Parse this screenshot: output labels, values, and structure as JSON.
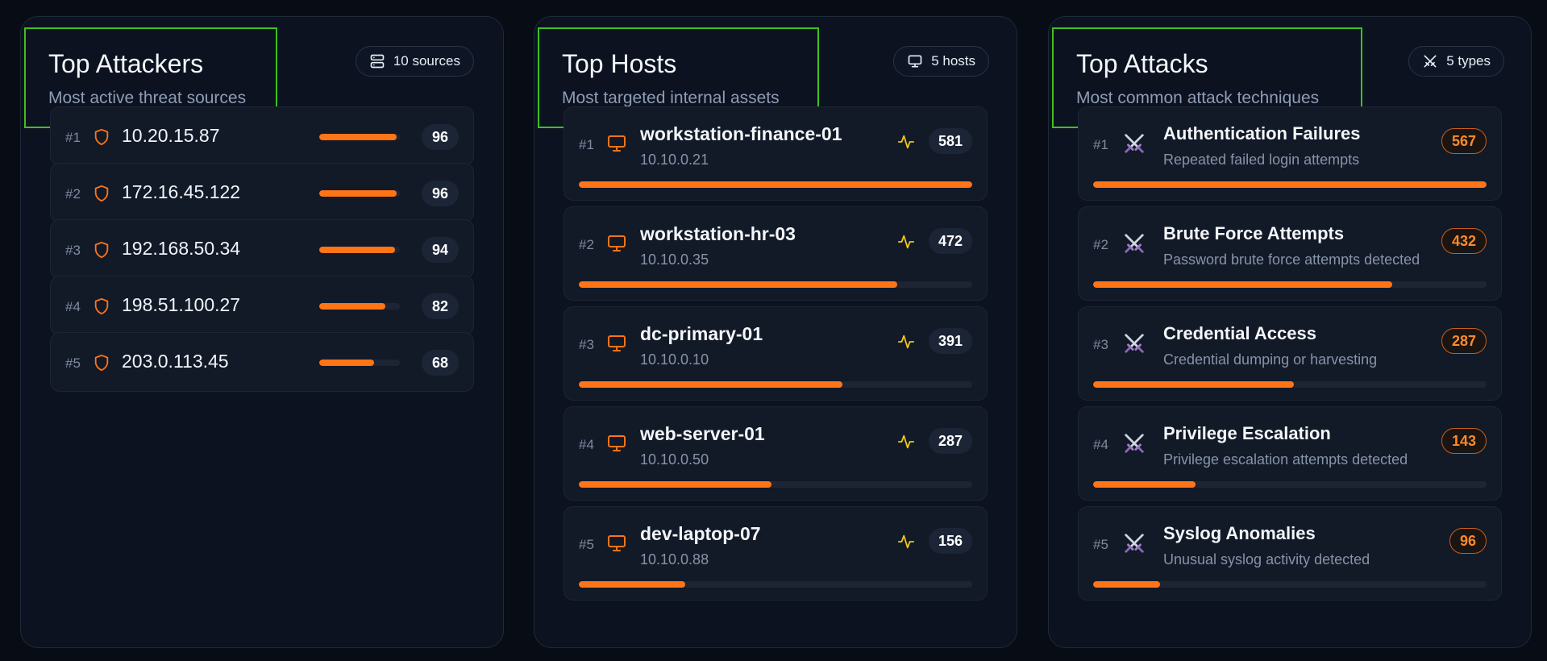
{
  "attackers": {
    "title": "Top Attackers",
    "subtitle": "Most active threat sources",
    "badge": "10 sources",
    "items": [
      {
        "rank": "#1",
        "ip": "10.20.15.87",
        "score": "96",
        "level": 0.96
      },
      {
        "rank": "#2",
        "ip": "172.16.45.122",
        "score": "96",
        "level": 0.96
      },
      {
        "rank": "#3",
        "ip": "192.168.50.34",
        "score": "94",
        "level": 0.94
      },
      {
        "rank": "#4",
        "ip": "198.51.100.27",
        "score": "82",
        "level": 0.82
      },
      {
        "rank": "#5",
        "ip": "203.0.113.45",
        "score": "68",
        "level": 0.68
      }
    ]
  },
  "hosts": {
    "title": "Top Hosts",
    "subtitle": "Most targeted internal assets",
    "badge": "5 hosts",
    "items": [
      {
        "rank": "#1",
        "name": "workstation-finance-01",
        "ip": "10.10.0.21",
        "count": "581",
        "level": 1.0
      },
      {
        "rank": "#2",
        "name": "workstation-hr-03",
        "ip": "10.10.0.35",
        "count": "472",
        "level": 0.81
      },
      {
        "rank": "#3",
        "name": "dc-primary-01",
        "ip": "10.10.0.10",
        "count": "391",
        "level": 0.67
      },
      {
        "rank": "#4",
        "name": "web-server-01",
        "ip": "10.10.0.50",
        "count": "287",
        "level": 0.49
      },
      {
        "rank": "#5",
        "name": "dev-laptop-07",
        "ip": "10.10.0.88",
        "count": "156",
        "level": 0.27
      }
    ]
  },
  "attacks": {
    "title": "Top Attacks",
    "subtitle": "Most common attack techniques",
    "badge": "5 types",
    "items": [
      {
        "rank": "#1",
        "name": "Authentication Failures",
        "description": "Repeated failed login attempts",
        "count": "567",
        "level": 1.0
      },
      {
        "rank": "#2",
        "name": "Brute Force Attempts",
        "description": "Password brute force attempts detected",
        "count": "432",
        "level": 0.76
      },
      {
        "rank": "#3",
        "name": "Credential Access",
        "description": "Credential dumping or harvesting",
        "count": "287",
        "level": 0.51
      },
      {
        "rank": "#4",
        "name": "Privilege Escalation",
        "description": "Privilege escalation attempts detected",
        "count": "143",
        "level": 0.26
      },
      {
        "rank": "#5",
        "name": "Syslog Anomalies",
        "description": "Unusual syslog activity detected",
        "count": "96",
        "level": 0.17
      }
    ]
  },
  "icons": {
    "attackers_badge": "server-icon",
    "attacker_row": "shield-icon",
    "hosts_badge": "monitor-icon",
    "host_row": "monitor-icon",
    "host_activity": "activity-pulse-icon",
    "attacks_badge": "crossed-swords-icon",
    "attack_row": "crossed-swords-icon"
  },
  "colors": {
    "accent": "#ff7417",
    "highlight_border": "#3ec21c",
    "pulse": "#f0c419",
    "background": "#080c14",
    "panel": "#0c1220"
  }
}
